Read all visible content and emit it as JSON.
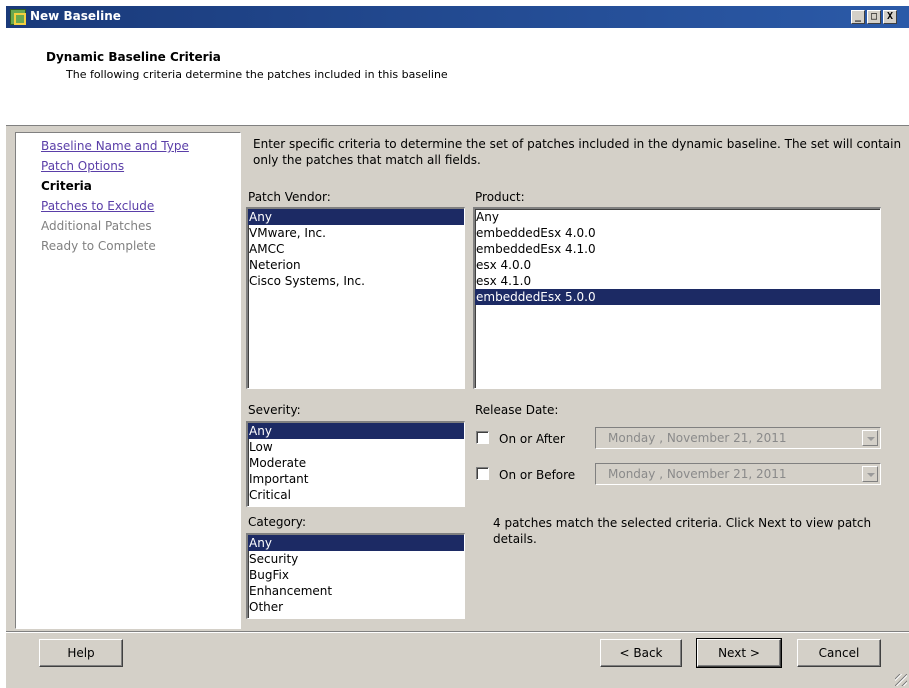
{
  "window": {
    "title": "New Baseline",
    "controls": {
      "minimize": "_",
      "maximize": "□",
      "close": "X"
    }
  },
  "header": {
    "title": "Dynamic Baseline Criteria",
    "subtitle": "The following criteria determine the patches included in this baseline"
  },
  "nav": {
    "items": [
      {
        "label": "Baseline Name and Type",
        "state": "link"
      },
      {
        "label": "Patch Options",
        "state": "link"
      },
      {
        "label": "Criteria",
        "state": "current"
      },
      {
        "label": "Patches to Exclude",
        "state": "link"
      },
      {
        "label": "Additional Patches",
        "state": "disabled"
      },
      {
        "label": "Ready to Complete",
        "state": "disabled"
      }
    ]
  },
  "main": {
    "instructions": "Enter specific criteria to determine the set of patches included in the dynamic baseline.  The set will contain only the patches that match all fields.",
    "patch_vendor": {
      "label": "Patch Vendor:",
      "items": [
        "Any",
        "VMware, Inc.",
        "AMCC",
        "Neterion",
        "Cisco Systems, Inc."
      ],
      "selected": "Any"
    },
    "product": {
      "label": "Product:",
      "items": [
        "Any",
        "embeddedEsx 4.0.0",
        "embeddedEsx 4.1.0",
        "esx 4.0.0",
        "esx 4.1.0",
        "embeddedEsx 5.0.0"
      ],
      "selected": "embeddedEsx 5.0.0"
    },
    "severity": {
      "label": "Severity:",
      "items": [
        "Any",
        "Low",
        "Moderate",
        "Important",
        "Critical"
      ],
      "selected": "Any"
    },
    "category": {
      "label": "Category:",
      "items": [
        "Any",
        "Security",
        "BugFix",
        "Enhancement",
        "Other"
      ],
      "selected": "Any"
    },
    "release_date": {
      "label": "Release Date:",
      "on_or_after": {
        "label": "On or After",
        "checked": false,
        "day": "Monday",
        "date": ", November 21, 2011"
      },
      "on_or_before": {
        "label": "On or Before",
        "checked": false,
        "day": "Monday",
        "date": ", November 21, 2011"
      }
    },
    "match_status": "4 patches match the selected criteria. Click Next to view patch details."
  },
  "footer": {
    "help": "Help",
    "back": "< Back",
    "next": "Next >",
    "cancel": "Cancel"
  },
  "colors": {
    "title_bar": "#1a3a7a",
    "selection": "#1c2a64",
    "link": "#5a3ea8",
    "face": "#d4d0c8"
  }
}
